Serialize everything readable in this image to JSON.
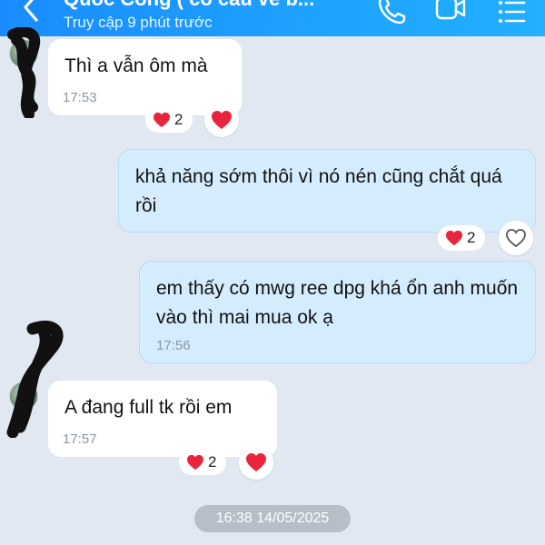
{
  "header": {
    "title": "Quốc Công ( cố cầu về b...",
    "last_seen": "Truy cập 9 phút trước"
  },
  "messages": [
    {
      "text": "Thì a vẫn ôm mà",
      "time": "17:53",
      "reaction": {
        "icon": "heart-icon",
        "count": "2"
      }
    },
    {
      "text": "khả năng sớm thôi vì nó nén cũng chắt quá rồi",
      "time": "",
      "reaction": {
        "icon": "heart-icon",
        "count": "2"
      }
    },
    {
      "text": "em thấy có mwg ree dpg khá ổn anh muốn vào thì mai mua ok ạ",
      "time": "17:56"
    },
    {
      "text": "A đang full tk rồi em",
      "time": "17:57",
      "reaction": {
        "icon": "heart-icon",
        "count": "2"
      }
    }
  ],
  "date_divider": "16:38 14/05/2025",
  "colors": {
    "header": "#1a8cff",
    "background": "#e2e8f1",
    "outgoing_bubble": "#d5ecfc",
    "incoming_bubble": "#ffffff",
    "heart": "#e8253c"
  }
}
